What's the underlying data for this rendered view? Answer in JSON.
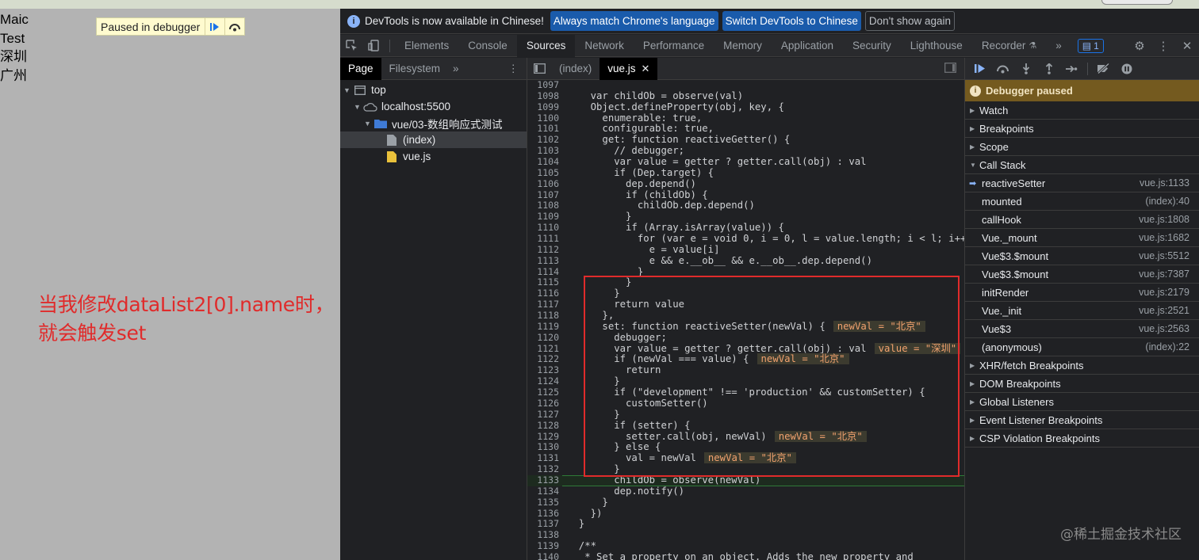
{
  "page": {
    "list": [
      "Maic",
      "Test",
      "深圳",
      "广州"
    ],
    "paused_banner": "Paused in debugger",
    "annotation": "当我修改dataList2[0].name时，就会触发set"
  },
  "infobar": {
    "message": "DevTools is now available in Chinese!",
    "btn_match": "Always match Chrome's language",
    "btn_switch": "Switch DevTools to Chinese",
    "btn_dismiss": "Don't show again"
  },
  "main_tabs": [
    "Elements",
    "Console",
    "Sources",
    "Network",
    "Performance",
    "Memory",
    "Application",
    "Security",
    "Lighthouse",
    "Recorder"
  ],
  "issues_badge": "1",
  "navigator": {
    "tabs": [
      "Page",
      "Filesystem"
    ],
    "tree": [
      "top",
      "localhost:5500",
      "vue/03-数组响应式测试",
      "(index)",
      "vue.js"
    ]
  },
  "editor": {
    "tabs": [
      "(index)",
      "vue.js"
    ]
  },
  "code_lines": [
    {
      "n": "1097",
      "src": ""
    },
    {
      "n": "1098",
      "src": "    var childOb = observe(val)"
    },
    {
      "n": "1099",
      "src": "    Object.defineProperty(obj, key, {"
    },
    {
      "n": "1100",
      "src": "      enumerable: true,"
    },
    {
      "n": "1101",
      "src": "      configurable: true,"
    },
    {
      "n": "1102",
      "src": "      get: function reactiveGetter() {"
    },
    {
      "n": "1103",
      "src": "        // debugger;"
    },
    {
      "n": "1104",
      "src": "        var value = getter ? getter.call(obj) : val"
    },
    {
      "n": "1105",
      "src": "        if (Dep.target) {"
    },
    {
      "n": "1106",
      "src": "          dep.depend()"
    },
    {
      "n": "1107",
      "src": "          if (childOb) {"
    },
    {
      "n": "1108",
      "src": "            childOb.dep.depend()"
    },
    {
      "n": "1109",
      "src": "          }"
    },
    {
      "n": "1110",
      "src": "          if (Array.isArray(value)) {"
    },
    {
      "n": "1111",
      "src": "            for (var e = void 0, i = 0, l = value.length; i < l; i++"
    },
    {
      "n": "1112",
      "src": "              e = value[i]"
    },
    {
      "n": "1113",
      "src": "              e && e.__ob__ && e.__ob__.dep.depend()"
    },
    {
      "n": "1114",
      "src": "            }"
    },
    {
      "n": "1115",
      "src": "          }"
    },
    {
      "n": "1116",
      "src": "        }"
    },
    {
      "n": "1117",
      "src": "        return value"
    },
    {
      "n": "1118",
      "src": "      },"
    },
    {
      "n": "1119",
      "src": "      set: function reactiveSetter(newVal) {"
    },
    {
      "n": "1120",
      "src": "        debugger;"
    },
    {
      "n": "1121",
      "src": "        var value = getter ? getter.call(obj) : val"
    },
    {
      "n": "1122",
      "src": "        if (newVal === value) {"
    },
    {
      "n": "1123",
      "src": "          return"
    },
    {
      "n": "1124",
      "src": "        }"
    },
    {
      "n": "1125",
      "src": "        if (\"development\" !== 'production' && customSetter) {"
    },
    {
      "n": "1126",
      "src": "          customSetter()"
    },
    {
      "n": "1127",
      "src": "        }"
    },
    {
      "n": "1128",
      "src": "        if (setter) {"
    },
    {
      "n": "1129",
      "src": "          setter.call(obj, newVal)"
    },
    {
      "n": "1130",
      "src": "        } else {"
    },
    {
      "n": "1131",
      "src": "          val = newVal"
    },
    {
      "n": "1132",
      "src": "        }"
    },
    {
      "n": "1133",
      "src": "        childOb = observe(newVal)"
    },
    {
      "n": "1134",
      "src": "        dep.notify()"
    },
    {
      "n": "1135",
      "src": "      }"
    },
    {
      "n": "1136",
      "src": "    })"
    },
    {
      "n": "1137",
      "src": "  }"
    },
    {
      "n": "1138",
      "src": ""
    },
    {
      "n": "1139",
      "src": "  /**"
    },
    {
      "n": "1140",
      "src": "   * Set a property on an object. Adds the new property and"
    }
  ],
  "inline_values": {
    "l1119": "newVal = \"北京\"",
    "l1121": "value = \"深圳\"",
    "l1122": "newVal = \"北京\"",
    "l1129": "newVal = \"北京\"",
    "l1131": "newVal = \"北京\""
  },
  "debugger": {
    "paused_label": "Debugger paused",
    "sections_top": [
      "Watch",
      "Breakpoints",
      "Scope",
      "Call Stack"
    ],
    "call_stack": [
      {
        "name": "reactiveSetter",
        "loc": "vue.js:1133"
      },
      {
        "name": "mounted",
        "loc": "(index):40"
      },
      {
        "name": "callHook",
        "loc": "vue.js:1808"
      },
      {
        "name": "Vue._mount",
        "loc": "vue.js:1682"
      },
      {
        "name": "Vue$3.$mount",
        "loc": "vue.js:5512"
      },
      {
        "name": "Vue$3.$mount",
        "loc": "vue.js:7387"
      },
      {
        "name": "initRender",
        "loc": "vue.js:2179"
      },
      {
        "name": "Vue._init",
        "loc": "vue.js:2521"
      },
      {
        "name": "Vue$3",
        "loc": "vue.js:2563"
      },
      {
        "name": "(anonymous)",
        "loc": "(index):22"
      }
    ],
    "sections_bottom": [
      "XHR/fetch Breakpoints",
      "DOM Breakpoints",
      "Global Listeners",
      "Event Listener Breakpoints",
      "CSP Violation Breakpoints"
    ]
  },
  "watermark": "@稀土掘金技术社区"
}
